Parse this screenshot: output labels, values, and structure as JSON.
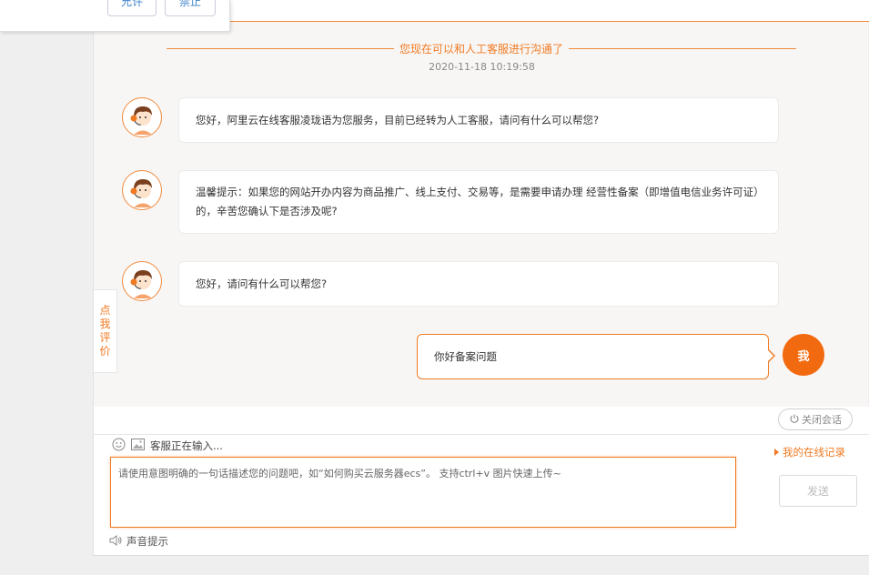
{
  "popup": {
    "allow_label": "允许",
    "deny_label": "禁止"
  },
  "notice": {
    "text": "您现在可以和人工客服进行沟通了",
    "timestamp": "2020-11-18 10:19:58"
  },
  "messages": [
    {
      "sender": "agent",
      "text": "您好，阿里云在线客服凌珑语为您服务，目前已经转为人工客服，请问有什么可以帮您?"
    },
    {
      "sender": "agent",
      "text": "温馨提示：如果您的网站开办内容为商品推广、线上支付、交易等，是需要申请办理 经营性备案（即增值电信业务许可证）的，辛苦您确认下是否涉及呢?"
    },
    {
      "sender": "agent",
      "text": "您好，请问有什么可以帮您?"
    },
    {
      "sender": "me",
      "text": "你好备案问题",
      "avatar_label": "我"
    }
  ],
  "rate_tab": [
    "点",
    "我",
    "评",
    "价"
  ],
  "end_session_label": "关闭会话",
  "typing_status": "客服正在输入...",
  "history_link": "我的在线记录",
  "input": {
    "placeholder": "请使用意图明确的一句话描述您的问题吧，如“如何购买云服务器ecs”。 支持ctrl+v 图片快速上传~"
  },
  "send_label": "发送",
  "sound_label": "声音提示",
  "colors": {
    "accent": "#f07a22",
    "me_avatar": "#f26a0f"
  },
  "icons": [
    "emoji-icon",
    "image-icon",
    "power-icon",
    "speaker-icon",
    "agent-avatar"
  ]
}
